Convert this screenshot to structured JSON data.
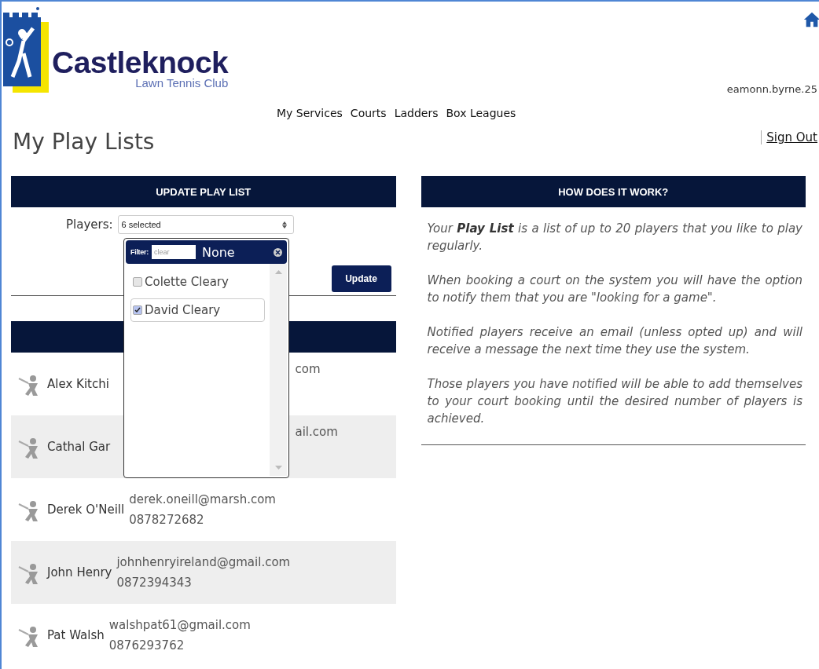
{
  "logo": {
    "name": "Castleknock",
    "tagline": "Lawn Tennis Club"
  },
  "nav": [
    "My Services",
    "Courts",
    "Ladders",
    "Box Leagues"
  ],
  "user": {
    "name": "eamonn.byrne.25",
    "sign_out": "Sign Out"
  },
  "page_title": "My Play Lists",
  "update_panel": {
    "title": "UPDATE PLAY LIST",
    "players_label": "Players:",
    "players_value": "6 selected",
    "button": "Update",
    "dropdown": {
      "filter_label": "Filter:",
      "filter_placeholder": "clear",
      "none_link": "None",
      "options": [
        {
          "label": "Colette Cleary",
          "checked": false,
          "focused": false
        },
        {
          "label": "David Cleary",
          "checked": true,
          "focused": true
        }
      ]
    }
  },
  "players": [
    {
      "name": "Alex Kitchi",
      "email": "com",
      "covered": true
    },
    {
      "name": "Cathal Gar",
      "email": "ail.com",
      "covered": true
    },
    {
      "name": "Derek O'Neill",
      "email": "derek.oneill@marsh.com",
      "phone": "0878272682",
      "covered": false
    },
    {
      "name": "John Henry",
      "email": "johnhenryireland@gmail.com",
      "phone": "0872394343",
      "covered": false
    },
    {
      "name": "Pat Walsh",
      "email": "walshpat61@gmail.com",
      "phone": "0876293762",
      "covered": false
    }
  ],
  "how_panel": {
    "title": "HOW DOES IT WORK?",
    "paragraphs": [
      "Your **Play List** is a list of up to 20 players that you like to play regularly.",
      "When booking a court on the system you will have the option to notify them that you are \"looking for a game\".",
      "Notified players receive an email (unless opted up) and will receive a message the next time they use the system.",
      "Those players you have notified will be able to add themselves to your court booking until the desired number of players is achieved."
    ]
  }
}
